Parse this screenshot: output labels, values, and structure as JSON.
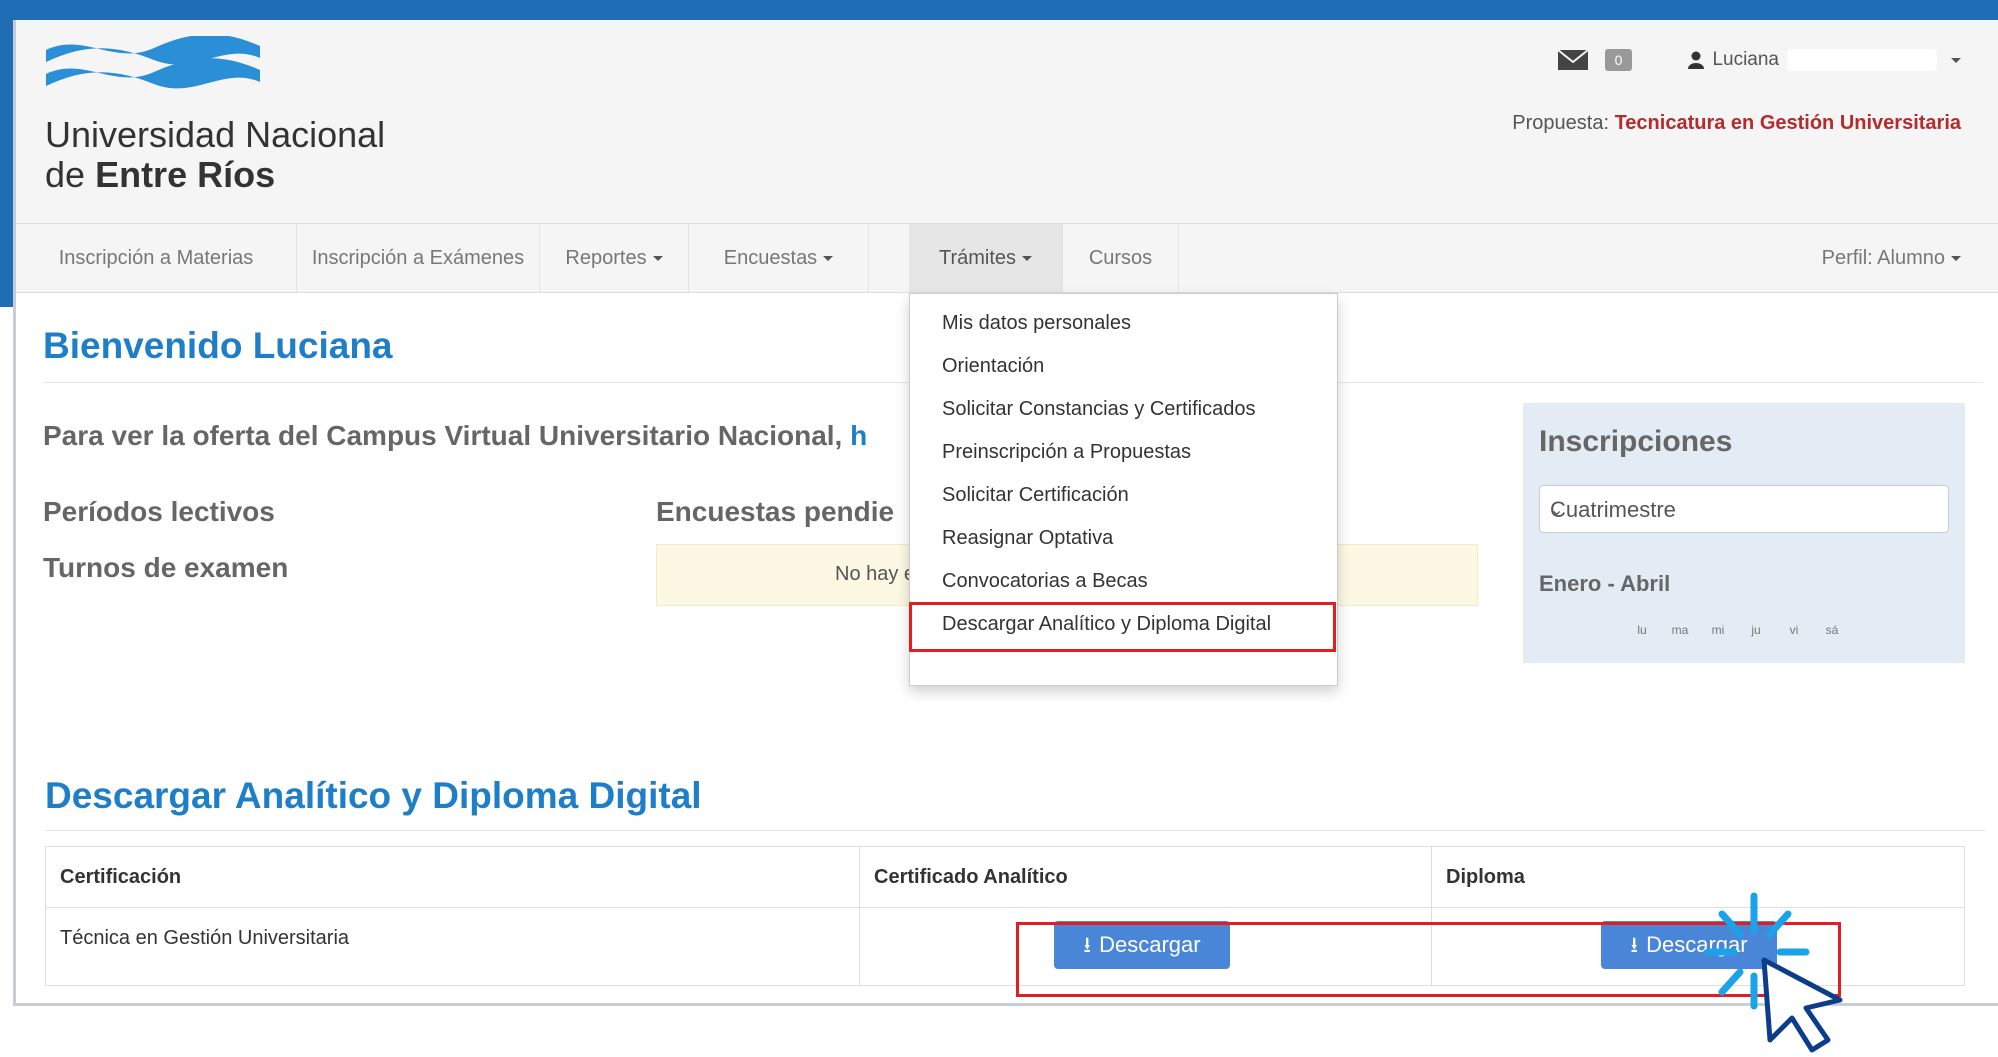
{
  "header": {
    "university_line1": "Universidad Nacional",
    "university_line2_prefix": "de",
    "university_line2_bold": "Entre Ríos",
    "message_count": "0",
    "user_name": "Luciana",
    "propuesta_label": "Propuesta:",
    "propuesta_value": "Tecnicatura en Gestión Universitaria"
  },
  "nav": {
    "items": [
      {
        "label": "Inscripción a Materias"
      },
      {
        "label": "Inscripción a Exámenes"
      },
      {
        "label": "Reportes"
      },
      {
        "label": "Encuestas"
      },
      {
        "label": "Trámites"
      },
      {
        "label": "Cursos"
      }
    ],
    "profile": "Perfil: Alumno"
  },
  "main": {
    "welcome": "Bienvenido Luciana",
    "oferta_text": "Para ver la oferta del Campus Virtual Universitario Nacional,",
    "oferta_link": "h",
    "periodos": "Períodos lectivos",
    "turnos": "Turnos de examen",
    "encuestas": "Encuestas pendie",
    "no_hay": "No hay e"
  },
  "dropdown": {
    "items": [
      "Mis datos personales",
      "Orientación",
      "Solicitar Constancias y Certificados",
      "Preinscripción a Propuestas",
      "Solicitar Certificación",
      "Reasignar Optativa",
      "Convocatorias a Becas",
      "Descargar Analítico y Diploma Digital"
    ]
  },
  "inscripciones": {
    "title": "Inscripciones",
    "select_value": "Cuatrimestre",
    "period": "Enero - Abril",
    "days": [
      "lu",
      "ma",
      "mi",
      "ju",
      "vi",
      "sá"
    ]
  },
  "descargar": {
    "title": "Descargar Analítico y Diploma Digital",
    "columns": [
      "Certificación",
      "Certificado Analítico",
      "Diploma"
    ],
    "row": {
      "certificacion": "Técnica en Gestión Universitaria",
      "analitico_button": "Descargar",
      "diploma_button": "Descargar"
    }
  },
  "colors": {
    "brand_blue": "#1f6eb5",
    "heading_blue": "#1e7ec8",
    "button_blue": "#4a86d8",
    "highlight_red": "#e02020",
    "propuesta_red": "#b52b2b"
  }
}
